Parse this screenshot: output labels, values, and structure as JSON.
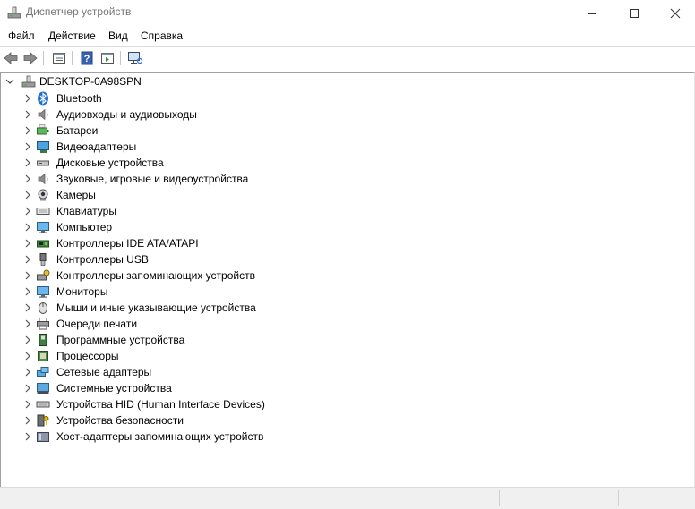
{
  "window": {
    "title": "Диспетчер устройств",
    "controls": [
      "minimize",
      "maximize",
      "close"
    ]
  },
  "menu": [
    "Файл",
    "Действие",
    "Вид",
    "Справка"
  ],
  "toolbar": [
    "back-icon",
    "forward-icon",
    "properties-icon",
    "help-icon",
    "action-pane-icon",
    "scan-hardware-icon"
  ],
  "tree": {
    "root": "DESKTOP-0A98SPN",
    "items": [
      {
        "label": "Bluetooth",
        "icon": "bluetooth-icon"
      },
      {
        "label": "Аудиовходы и аудиовыходы",
        "icon": "speaker-icon"
      },
      {
        "label": "Батареи",
        "icon": "battery-icon"
      },
      {
        "label": "Видеоадаптеры",
        "icon": "display-adapter-icon"
      },
      {
        "label": "Дисковые устройства",
        "icon": "disk-drive-icon"
      },
      {
        "label": "Звуковые, игровые и видеоустройства",
        "icon": "speaker-icon"
      },
      {
        "label": "Камеры",
        "icon": "camera-icon"
      },
      {
        "label": "Клавиатуры",
        "icon": "keyboard-icon"
      },
      {
        "label": "Компьютер",
        "icon": "monitor-icon"
      },
      {
        "label": "Контроллеры IDE ATA/ATAPI",
        "icon": "ide-controller-icon"
      },
      {
        "label": "Контроллеры USB",
        "icon": "usb-icon"
      },
      {
        "label": "Контроллеры запоминающих устройств",
        "icon": "storage-controller-icon"
      },
      {
        "label": "Мониторы",
        "icon": "monitor-icon"
      },
      {
        "label": "Мыши и иные указывающие устройства",
        "icon": "mouse-icon"
      },
      {
        "label": "Очереди печати",
        "icon": "printer-icon"
      },
      {
        "label": "Программные устройства",
        "icon": "software-device-icon"
      },
      {
        "label": "Процессоры",
        "icon": "processor-icon"
      },
      {
        "label": "Сетевые адаптеры",
        "icon": "network-adapter-icon"
      },
      {
        "label": "Системные устройства",
        "icon": "system-device-icon"
      },
      {
        "label": "Устройства HID (Human Interface Devices)",
        "icon": "hid-icon"
      },
      {
        "label": "Устройства безопасности",
        "icon": "security-device-icon"
      },
      {
        "label": "Хост-адаптеры запоминающих устройств",
        "icon": "storage-host-icon"
      }
    ]
  }
}
